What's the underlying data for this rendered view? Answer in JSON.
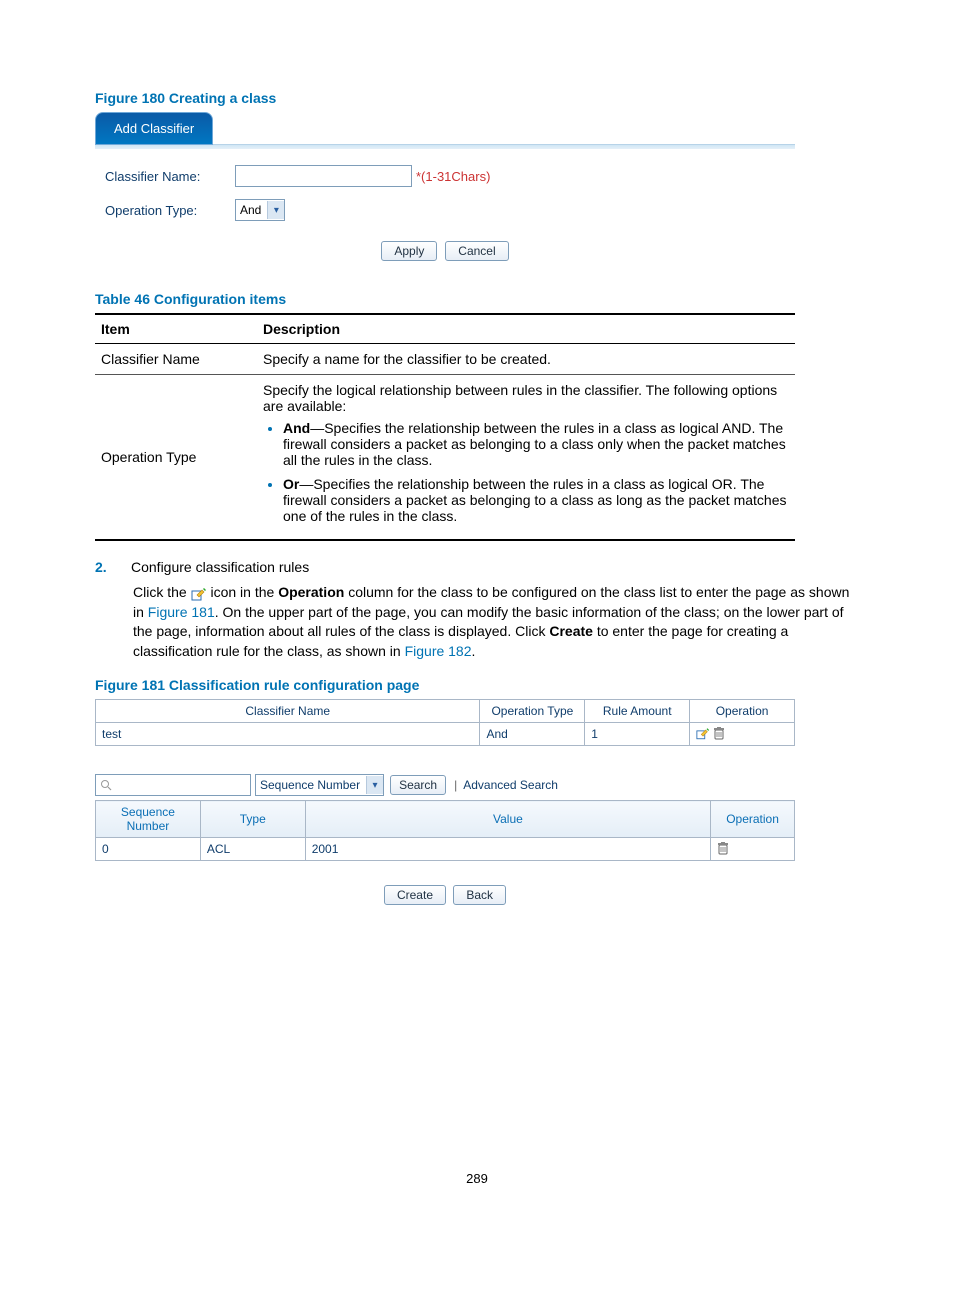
{
  "page_number": "289",
  "figure180": {
    "caption": "Figure 180 Creating a class",
    "tab_title": "Add Classifier",
    "label_classifier_name": "Classifier Name:",
    "label_operation_type": "Operation Type:",
    "input_hint": "*(1-31Chars)",
    "operation_type_value": "And",
    "btn_apply": "Apply",
    "btn_cancel": "Cancel"
  },
  "table46": {
    "caption": "Table 46 Configuration items",
    "col_item": "Item",
    "col_description": "Description",
    "row1_item": "Classifier Name",
    "row1_desc": "Specify a name for the classifier to be created.",
    "row2_item": "Operation Type",
    "row2_intro": "Specify the logical relationship between rules in the classifier. The following options are available:",
    "row2_bullet1_lead": "And",
    "row2_bullet1_rest": "—Specifies the relationship between the rules in a class as logical AND. The firewall considers a packet as belonging to a class only when the packet matches all the rules in the class.",
    "row2_bullet2_lead": "Or",
    "row2_bullet2_rest": "—Specifies the relationship between the rules in a class as logical OR. The firewall considers a packet as belonging to a class as long as the packet matches one of the rules in the class."
  },
  "step2": {
    "number": "2.",
    "title": "Configure classification rules",
    "para_1a": "Click the ",
    "para_1b": " icon in the ",
    "para_bold1": "Operation",
    "para_1c": " column for the class to be configured on the class list to enter the page as shown in ",
    "link1": "Figure 181",
    "para_1d": ". On the upper part of the page, you can modify the basic information of the class; on the lower part of the page, information about all rules of the class is displayed. Click ",
    "para_bold2": "Create",
    "para_1e": " to enter the page for creating a classification rule for the class, as shown in ",
    "link2": "Figure 182",
    "para_1f": "."
  },
  "figure181": {
    "caption": "Figure 181 Classification rule configuration page",
    "headers": {
      "classifier_name": "Classifier Name",
      "operation_type": "Operation Type",
      "rule_amount": "Rule Amount",
      "operation": "Operation"
    },
    "row": {
      "classifier_name": "test",
      "operation_type": "And",
      "rule_amount": "1"
    },
    "search": {
      "filter_value": "Sequence Number",
      "btn_search": "Search",
      "link_advanced": "Advanced Search"
    },
    "rules_table": {
      "col_seq": "Sequence Number",
      "col_type": "Type",
      "col_value": "Value",
      "col_operation": "Operation",
      "row_seq": "0",
      "row_type": "ACL",
      "row_value": "2001"
    },
    "btn_create": "Create",
    "btn_back": "Back"
  }
}
